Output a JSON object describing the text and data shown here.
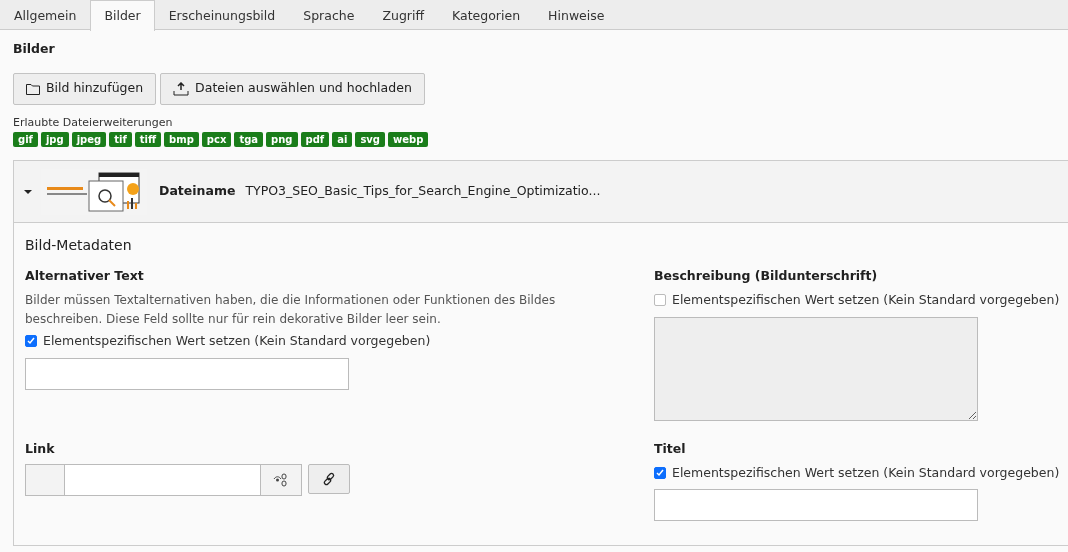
{
  "tabs": [
    {
      "label": "Allgemein",
      "selected": false
    },
    {
      "label": "Bilder",
      "selected": true
    },
    {
      "label": "Erscheinungsbild",
      "selected": false
    },
    {
      "label": "Sprache",
      "selected": false
    },
    {
      "label": "Zugriff",
      "selected": false
    },
    {
      "label": "Kategorien",
      "selected": false
    },
    {
      "label": "Hinweise",
      "selected": false
    }
  ],
  "section_title": "Bilder",
  "buttons": [
    {
      "label": "Bild hinzufügen",
      "kind": "folder"
    },
    {
      "label": "Dateien auswählen und hochladen",
      "kind": "upload"
    }
  ],
  "allowed_extensions": {
    "label": "Erlaubte Dateierweiterungen",
    "items": [
      "gif",
      "jpg",
      "jpeg",
      "tif",
      "tiff",
      "bmp",
      "pcx",
      "tga",
      "png",
      "pdf",
      "ai",
      "svg",
      "webp"
    ]
  },
  "file": {
    "expanded": true,
    "label": "Dateiname",
    "value": "TYPO3_SEO_Basic_Tips_for_Search_Engine_Optimizatio..."
  },
  "metadata_title": "Bild-Metadaten",
  "fields": [
    {
      "kind": "text",
      "label": "Alternativer Text",
      "description": "Bilder müssen Textalternativen haben, die die Informationen oder Funktionen des Bildes beschreiben. Diese Feld sollte nur für rein dekorative Bilder leer sein.",
      "override": {
        "label": "Elementspezifischen Wert setzen (Kein Standard vorgegeben)",
        "checked": true
      },
      "disabled": false
    },
    {
      "kind": "textarea",
      "label": "Beschreibung (Bildunterschrift)",
      "override": {
        "label": "Elementspezifischen Wert setzen (Kein Standard vorgegeben)",
        "checked": false
      },
      "disabled": true
    },
    {
      "kind": "link",
      "label": "Link",
      "disabled": false
    },
    {
      "kind": "text",
      "label": "Titel",
      "override": {
        "label": "Elementspezifischen Wert setzen (Kein Standard vorgegeben)",
        "checked": true
      },
      "disabled": false
    }
  ]
}
